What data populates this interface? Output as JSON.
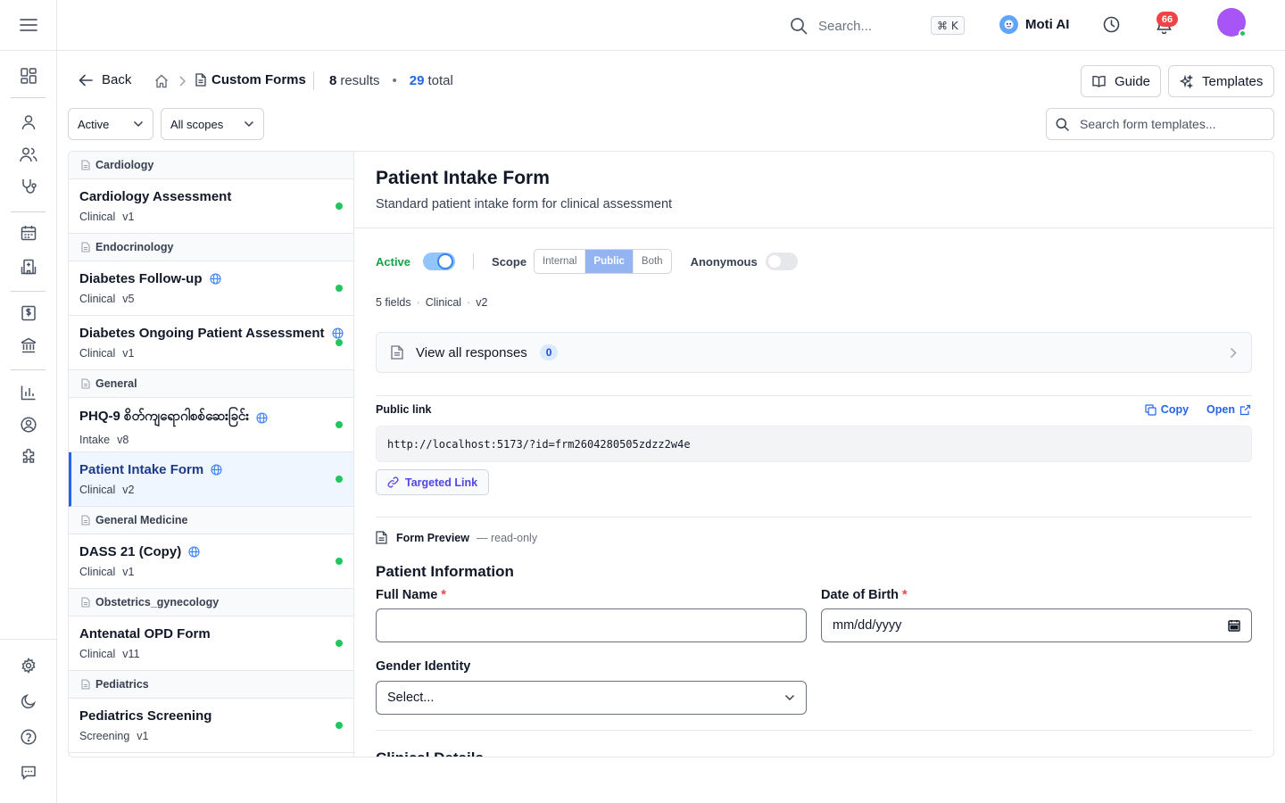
{
  "topbar": {
    "search_placeholder": "Search...",
    "shortcut": "⌘ K",
    "assistant_name": "Moti AI",
    "notification_count": "66"
  },
  "header": {
    "back_label": "Back",
    "breadcrumb_current": "Custom Forms",
    "results_count": "8",
    "results_label": "results",
    "total_count": "29",
    "total_label": "total",
    "guide_label": "Guide",
    "templates_label": "Templates"
  },
  "filters": {
    "status_value": "Active",
    "scope_value": "All scopes",
    "search_placeholder": "Search form templates..."
  },
  "list": {
    "groups": [
      {
        "name": "Cardiology",
        "items": [
          {
            "title": "Cardiology Assessment",
            "category": "Clinical",
            "version": "v1"
          }
        ]
      },
      {
        "name": "Endocrinology",
        "items": [
          {
            "title": "Diabetes Follow-up",
            "category": "Clinical",
            "version": "v5"
          },
          {
            "title": "Diabetes Ongoing Patient Assessment",
            "category": "Clinical",
            "version": "v1"
          }
        ]
      },
      {
        "name": "General",
        "items": [
          {
            "title": "PHQ-9 စိတ်ကျရောဂါစစ်ဆေးခြင်း",
            "category": "Intake",
            "version": "v8"
          },
          {
            "title": "Patient Intake Form",
            "category": "Clinical",
            "version": "v2"
          }
        ]
      },
      {
        "name": "General Medicine",
        "items": [
          {
            "title": "DASS 21 (Copy)",
            "category": "Clinical",
            "version": "v1"
          }
        ]
      },
      {
        "name": "Obstetrics_gynecology",
        "items": [
          {
            "title": "Antenatal OPD Form",
            "category": "Clinical",
            "version": "v11"
          }
        ]
      },
      {
        "name": "Pediatrics",
        "items": [
          {
            "title": "Pediatrics Screening",
            "category": "Screening",
            "version": "v1"
          }
        ]
      }
    ]
  },
  "detail": {
    "title": "Patient Intake Form",
    "subtitle": "Standard patient intake form for clinical assessment",
    "active_label": "Active",
    "scope_label": "Scope",
    "scope_options": [
      "Internal",
      "Public",
      "Both"
    ],
    "scope_selected": "Public",
    "anonymous_label": "Anonymous",
    "fields_count": "5 fields",
    "category": "Clinical",
    "version": "v2",
    "responses_label": "View all responses",
    "responses_count": "0",
    "public_link_label": "Public link",
    "copy_label": "Copy",
    "open_label": "Open",
    "public_link_url": "http://localhost:5173/?id=frm2604280505zdzz2w4e",
    "targeted_link_label": "Targeted Link",
    "preview_label": "Form Preview",
    "preview_note": "— read-only",
    "section_title": "Patient Information",
    "full_name_label": "Full Name",
    "dob_label": "Date of Birth",
    "dob_placeholder": "mm/dd/yyyy",
    "gender_label": "Gender Identity",
    "gender_value": "Select...",
    "next_section_title": "Clinical Details"
  },
  "colors": {
    "accent": "#2563eb",
    "active_green": "#16a34a",
    "status_dot": "#22c55e",
    "badge_red": "#ef4444",
    "avatar": "#a855f7"
  }
}
